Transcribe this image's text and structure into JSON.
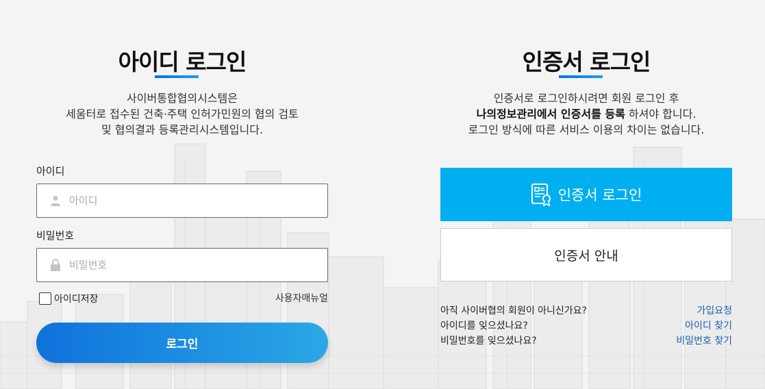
{
  "id_login": {
    "title": "아이디 로그인",
    "desc_line1": "사이버통합협의시스템은",
    "desc_line2": "세움터로 접수된 건축·주택 인허가민원의 협의 검토",
    "desc_line3": "및 협의결과 등록관리시스템입니다.",
    "id_label": "아이디",
    "id_placeholder": "아이디",
    "id_icon": "user-icon",
    "pw_label": "비밀번호",
    "pw_placeholder": "비밀번호",
    "pw_icon": "lock-icon",
    "remember_label": "아이디저장",
    "manual_link": "사용자매뉴얼",
    "login_button": "로그인"
  },
  "cert_login": {
    "title": "인증서 로그인",
    "desc_line1": "인증서로 로그인하시려면 회원 로그인 후",
    "desc_line2_bold": "나의정보관리에서 인증서를 등록",
    "desc_line2_rest": " 하셔야 합니다.",
    "desc_line3": "로그인 방식에 따른 서비스 이용의 차이는 없습니다.",
    "cert_button": "인증서 로그인",
    "cert_icon": "certificate-icon",
    "guide_button": "인증서 안내",
    "help": [
      {
        "question": "아직 사이버협의 회원이 아니신가요?",
        "action": "가입요청"
      },
      {
        "question": "아이디를 잊으셨나요?",
        "action": "아이디 찾기"
      },
      {
        "question": "비밀번호를 잊으셨나요?",
        "action": "비밀번호 찾기"
      }
    ]
  },
  "colors": {
    "accent": "#00aff0",
    "login_gradient_start": "#0f72dc",
    "login_gradient_end": "#2aa8e6",
    "link": "#1a5fb4",
    "background": "#f4f4f4"
  }
}
